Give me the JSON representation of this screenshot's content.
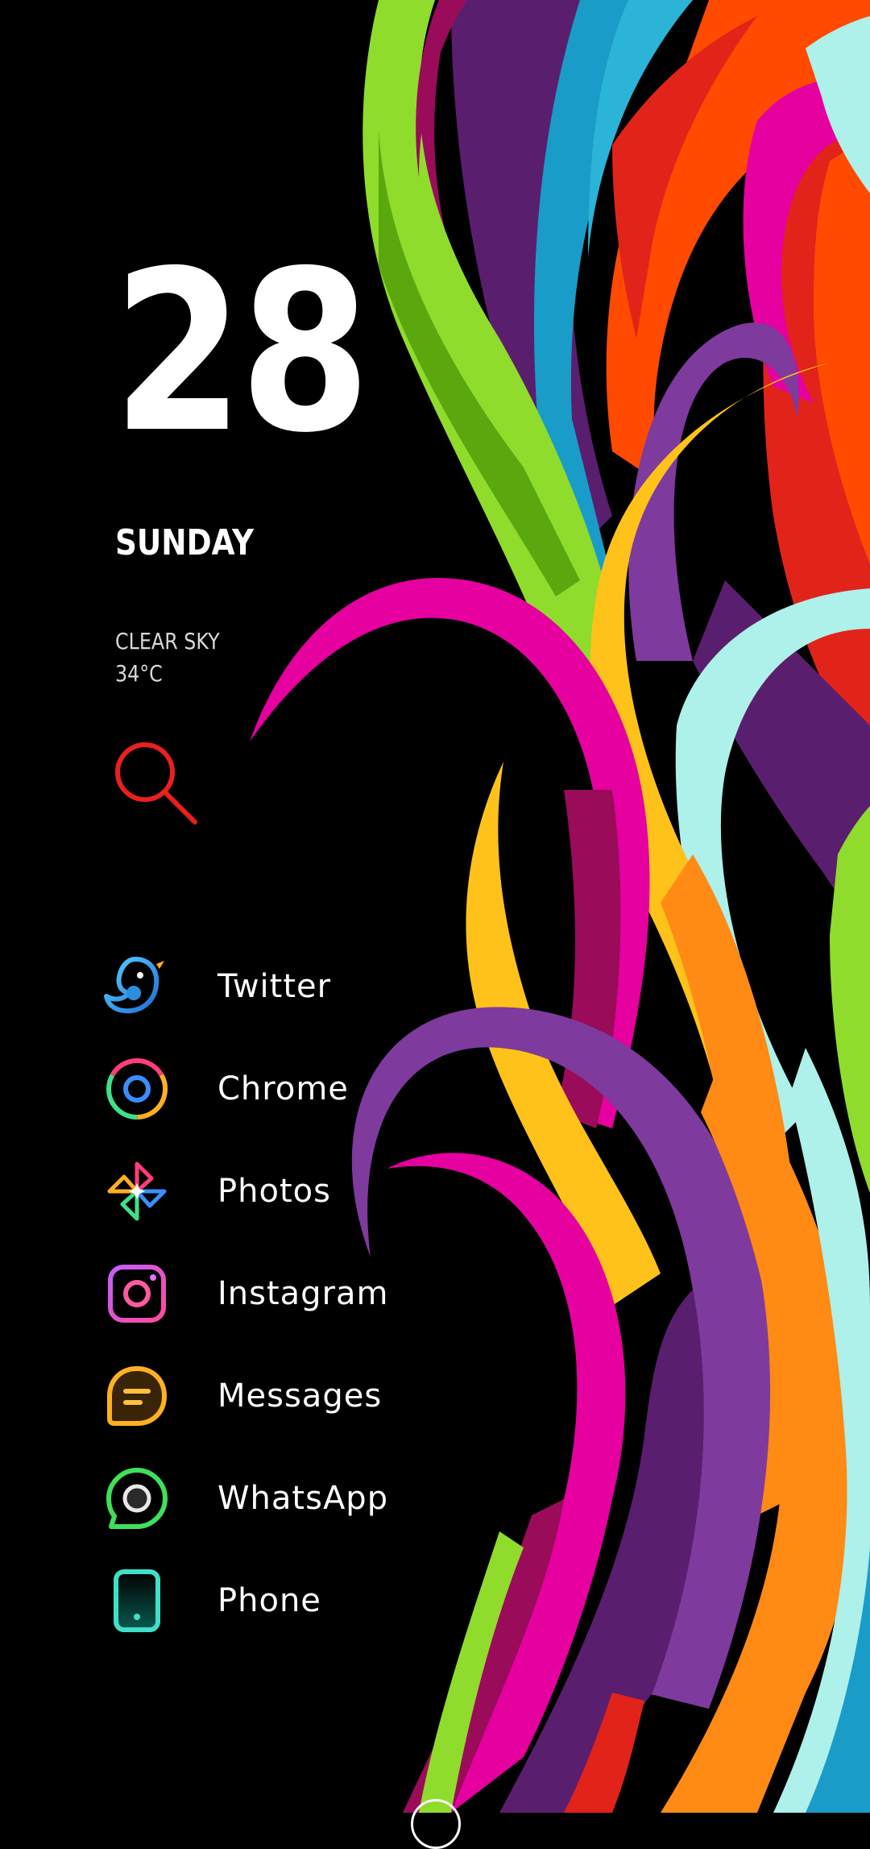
{
  "clock": {
    "date": "28",
    "day": "SUNDAY"
  },
  "weather": {
    "condition": "CLEAR SKY",
    "temperature": "34°C"
  },
  "search": {
    "icon": "search-icon",
    "color": "#e8201e"
  },
  "apps": [
    {
      "label": "Twitter",
      "icon": "twitter-bird-icon"
    },
    {
      "label": "Chrome",
      "icon": "chrome-icon"
    },
    {
      "label": "Photos",
      "icon": "photos-pinwheel-icon"
    },
    {
      "label": "Instagram",
      "icon": "instagram-icon"
    },
    {
      "label": "Messages",
      "icon": "messages-icon"
    },
    {
      "label": "WhatsApp",
      "icon": "whatsapp-icon"
    },
    {
      "label": "Phone",
      "icon": "phone-icon"
    }
  ],
  "wallpaper_colors": [
    "#8fdc2c",
    "#5a1e6e",
    "#1a9cc8",
    "#e2231a",
    "#ff4a00",
    "#e600a0",
    "#7e3a9c",
    "#ffc21a",
    "#ff8a14",
    "#aef0ea"
  ]
}
